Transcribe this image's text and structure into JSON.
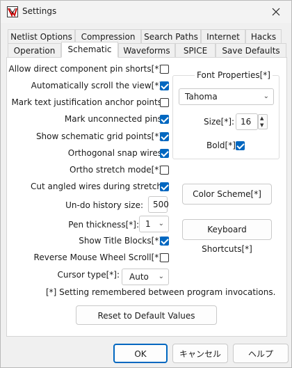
{
  "window": {
    "title": "Settings"
  },
  "tabs_row1": [
    "Netlist Options",
    "Compression",
    "Search Paths",
    "Internet",
    "Hacks"
  ],
  "tabs_row2": [
    "Operation",
    "Schematic",
    "Waveforms",
    "SPICE",
    "Save Defaults"
  ],
  "active_tab": "Schematic",
  "options": [
    {
      "label": "Allow direct component pin shorts[*]",
      "checked": false
    },
    {
      "label": "Automatically scroll the view[*]",
      "checked": true
    },
    {
      "label": "Mark text justification anchor points",
      "checked": false
    },
    {
      "label": "Mark unconnected pins",
      "checked": true
    },
    {
      "label": "Show schematic grid points[*]",
      "checked": true
    },
    {
      "label": "Orthogonal snap wires",
      "checked": true
    },
    {
      "label": "Ortho stretch mode[*]",
      "checked": false
    },
    {
      "label": "Cut angled wires during stretch",
      "checked": true
    }
  ],
  "undo": {
    "label": "Un-do history size:",
    "value": "500"
  },
  "pen": {
    "label": "Pen thickness[*]:",
    "value": "1"
  },
  "show_title_blocks": {
    "label": "Show Title Blocks[*]",
    "checked": true
  },
  "reverse_wheel": {
    "label": "Reverse Mouse Wheel Scroll[*]",
    "checked": false
  },
  "cursor": {
    "label": "Cursor type[*]:",
    "value": "Auto"
  },
  "font": {
    "group_title": "Font Properties[*]",
    "family": "Tahoma",
    "size_label": "Size[*]:",
    "size": "16",
    "bold_label": "Bold[*]",
    "bold": true
  },
  "buttons": {
    "color_scheme": "Color Scheme[*]",
    "keyboard_shortcuts": "Keyboard Shortcuts[*]",
    "reset": "Reset to Default Values",
    "ok": "OK",
    "cancel": "キャンセル",
    "help": "ヘルプ"
  },
  "footnote": "[*] Setting remembered between program invocations.",
  "colors": {
    "accent": "#0067c0"
  }
}
